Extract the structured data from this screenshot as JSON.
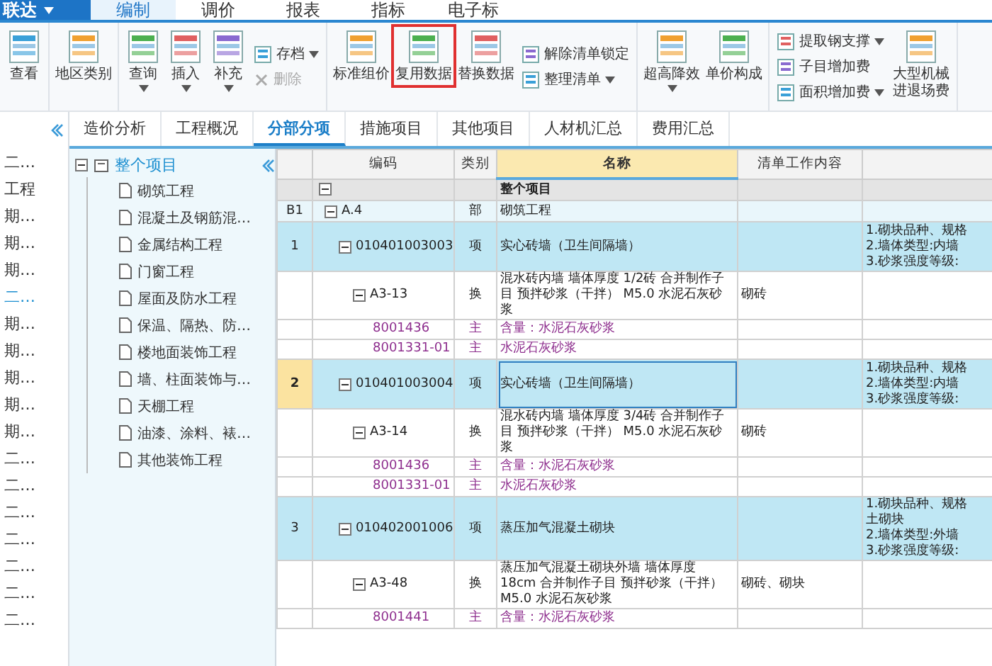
{
  "app_bar": {
    "brand": "联达",
    "tabs": [
      {
        "label": "编制",
        "selected": true
      },
      {
        "label": "调价",
        "selected": false
      },
      {
        "label": "报表",
        "selected": false
      },
      {
        "label": "指标",
        "selected": false
      },
      {
        "label": "电子标",
        "selected": false
      }
    ]
  },
  "ribbon": {
    "groups": [
      {
        "items": [
          {
            "kind": "large",
            "label": "查看",
            "menu": false,
            "highlighted": false
          }
        ]
      },
      {
        "items": [
          {
            "kind": "large",
            "label": "地区类别",
            "menu": false,
            "highlighted": false
          }
        ]
      },
      {
        "items": [
          {
            "kind": "large",
            "label": "查询",
            "menu": true,
            "highlighted": false
          },
          {
            "kind": "large",
            "label": "插入",
            "menu": true,
            "highlighted": false
          },
          {
            "kind": "large",
            "label": "补充",
            "menu": true,
            "highlighted": false
          },
          {
            "kind": "stack",
            "buttons": [
              {
                "label": "存档",
                "menu": true,
                "disabled": false
              },
              {
                "label": "删除",
                "menu": false,
                "disabled": true
              }
            ]
          }
        ]
      },
      {
        "items": [
          {
            "kind": "large",
            "label": "标准组价",
            "menu": false,
            "highlighted": false
          },
          {
            "kind": "large",
            "label": "复用数据",
            "menu": false,
            "highlighted": true
          },
          {
            "kind": "large",
            "label": "替换数据",
            "menu": false,
            "highlighted": false
          },
          {
            "kind": "stack",
            "buttons": [
              {
                "label": "解除清单锁定",
                "menu": false,
                "disabled": false
              },
              {
                "label": "整理清单",
                "menu": true,
                "disabled": false
              }
            ]
          }
        ]
      },
      {
        "items": [
          {
            "kind": "large",
            "label": "超高降效",
            "menu": true,
            "highlighted": false
          },
          {
            "kind": "large",
            "label": "单价构成",
            "menu": false,
            "highlighted": false
          }
        ]
      },
      {
        "items": [
          {
            "kind": "stack",
            "buttons": [
              {
                "label": "提取钢支撑",
                "menu": true,
                "disabled": false
              },
              {
                "label": "子目增加费",
                "menu": false,
                "disabled": false
              },
              {
                "label": "面积增加费",
                "menu": true,
                "disabled": false
              }
            ]
          },
          {
            "kind": "large",
            "label": "大型机械进退场费",
            "menu": false,
            "highlighted": false
          }
        ]
      }
    ]
  },
  "sidebar": {
    "items": [
      {
        "label": "二…",
        "selected": false
      },
      {
        "label": "工程",
        "selected": false
      },
      {
        "label": "期…",
        "selected": false
      },
      {
        "label": "期…",
        "selected": false
      },
      {
        "label": "期…",
        "selected": false
      },
      {
        "label": "二…",
        "selected": true
      },
      {
        "label": "期…",
        "selected": false
      },
      {
        "label": "期…",
        "selected": false
      },
      {
        "label": "期…",
        "selected": false
      },
      {
        "label": "期…",
        "selected": false
      },
      {
        "label": "期…",
        "selected": false
      },
      {
        "label": "二…",
        "selected": false
      },
      {
        "label": "二…",
        "selected": false
      },
      {
        "label": "二…",
        "selected": false
      },
      {
        "label": "二…",
        "selected": false
      },
      {
        "label": "二…",
        "selected": false
      },
      {
        "label": "二…",
        "selected": false
      },
      {
        "label": "二…",
        "selected": false
      }
    ]
  },
  "tabs": [
    {
      "label": "造价分析",
      "selected": false
    },
    {
      "label": "工程概况",
      "selected": false
    },
    {
      "label": "分部分项",
      "selected": true
    },
    {
      "label": "措施项目",
      "selected": false
    },
    {
      "label": "其他项目",
      "selected": false
    },
    {
      "label": "人材机汇总",
      "selected": false
    },
    {
      "label": "费用汇总",
      "selected": false
    }
  ],
  "tree": {
    "root": "整个项目",
    "expanded": true,
    "children": [
      "砌筑工程",
      "混凝土及钢筋混…",
      "金属结构工程",
      "门窗工程",
      "屋面及防水工程",
      "保温、隔热、防…",
      "楼地面装饰工程",
      "墙、柱面装饰与…",
      "天棚工程",
      "油漆、涂料、裱…",
      "其他装饰工程"
    ]
  },
  "table": {
    "columns": [
      {
        "label": "编码",
        "sorted": false
      },
      {
        "label": "类别",
        "sorted": false
      },
      {
        "label": "名称",
        "sorted": true
      },
      {
        "label": "清单工作内容",
        "sorted": false
      }
    ],
    "rows": [
      {
        "kind": "root",
        "name": "整个项目",
        "expanded": true,
        "selected": false,
        "children": [
          {
            "kind": "section",
            "number": "B1",
            "code": "A.4",
            "type": "部",
            "name": "砌筑工程",
            "expanded": true,
            "selected": false,
            "children": [
              {
                "kind": "item",
                "number": "1",
                "code": "010401003003",
                "type": "项",
                "name": "实心砖墙（卫生间隔墙）",
                "features": [
                  "1.砌块品种、规格",
                  "2.墙体类型:内墙",
                  "3.砂浆强度等级:"
                ],
                "expanded": true,
                "selected": false,
                "children": [
                  {
                    "kind": "norm",
                    "code": "A3-13",
                    "type": "换",
                    "name": "混水砖内墙 墙体厚度 1/2砖  合并制作子目 预拌砂浆（干拌） M5.0 水泥石灰砂浆",
                    "content": "砌砖",
                    "expanded": true,
                    "selected": false,
                    "children": [
                      {
                        "kind": "material",
                        "code": "8001436",
                        "type": "主",
                        "name": "含量：水泥石灰砂浆",
                        "selected": false
                      },
                      {
                        "kind": "material",
                        "code": "8001331-01",
                        "type": "主",
                        "name": "水泥石灰砂浆",
                        "selected": false
                      }
                    ]
                  }
                ]
              },
              {
                "kind": "item",
                "number": "2",
                "code": "010401003004",
                "type": "项",
                "name": "实心砖墙（卫生间隔墙）",
                "features": [
                  "1.砌块品种、规格",
                  "2.墙体类型:内墙",
                  "3.砂浆强度等级:"
                ],
                "expanded": true,
                "selected": true,
                "children": [
                  {
                    "kind": "norm",
                    "code": "A3-14",
                    "type": "换",
                    "name": "混水砖内墙 墙体厚度 3/4砖  合并制作子目 预拌砂浆（干拌） M5.0 水泥石灰砂浆",
                    "content": "砌砖",
                    "expanded": true,
                    "selected": false,
                    "children": [
                      {
                        "kind": "material",
                        "code": "8001436",
                        "type": "主",
                        "name": "含量：水泥石灰砂浆",
                        "selected": false
                      },
                      {
                        "kind": "material",
                        "code": "8001331-01",
                        "type": "主",
                        "name": "水泥石灰砂浆",
                        "selected": false
                      }
                    ]
                  }
                ]
              },
              {
                "kind": "item",
                "number": "3",
                "code": "010402001006",
                "type": "项",
                "name": "蒸压加气混凝土砌块",
                "features": [
                  "1.砌块品种、规格",
                  "土砌块",
                  "2.墙体类型:外墙",
                  "3.砂浆强度等级:"
                ],
                "expanded": true,
                "selected": false,
                "children": [
                  {
                    "kind": "norm",
                    "code": "A3-48",
                    "type": "换",
                    "name": "蒸压加气混凝土砌块外墙 墙体厚度 18cm  合并制作子目 预拌砂浆（干拌） M5.0 水泥石灰砂浆",
                    "content": "砌砖、砌块",
                    "expanded": true,
                    "selected": false,
                    "children": [
                      {
                        "kind": "material",
                        "code": "8001441",
                        "type": "主",
                        "name": "含量：水泥石灰砂浆",
                        "selected": false
                      }
                    ]
                  }
                ]
              }
            ]
          }
        ]
      }
    ]
  }
}
